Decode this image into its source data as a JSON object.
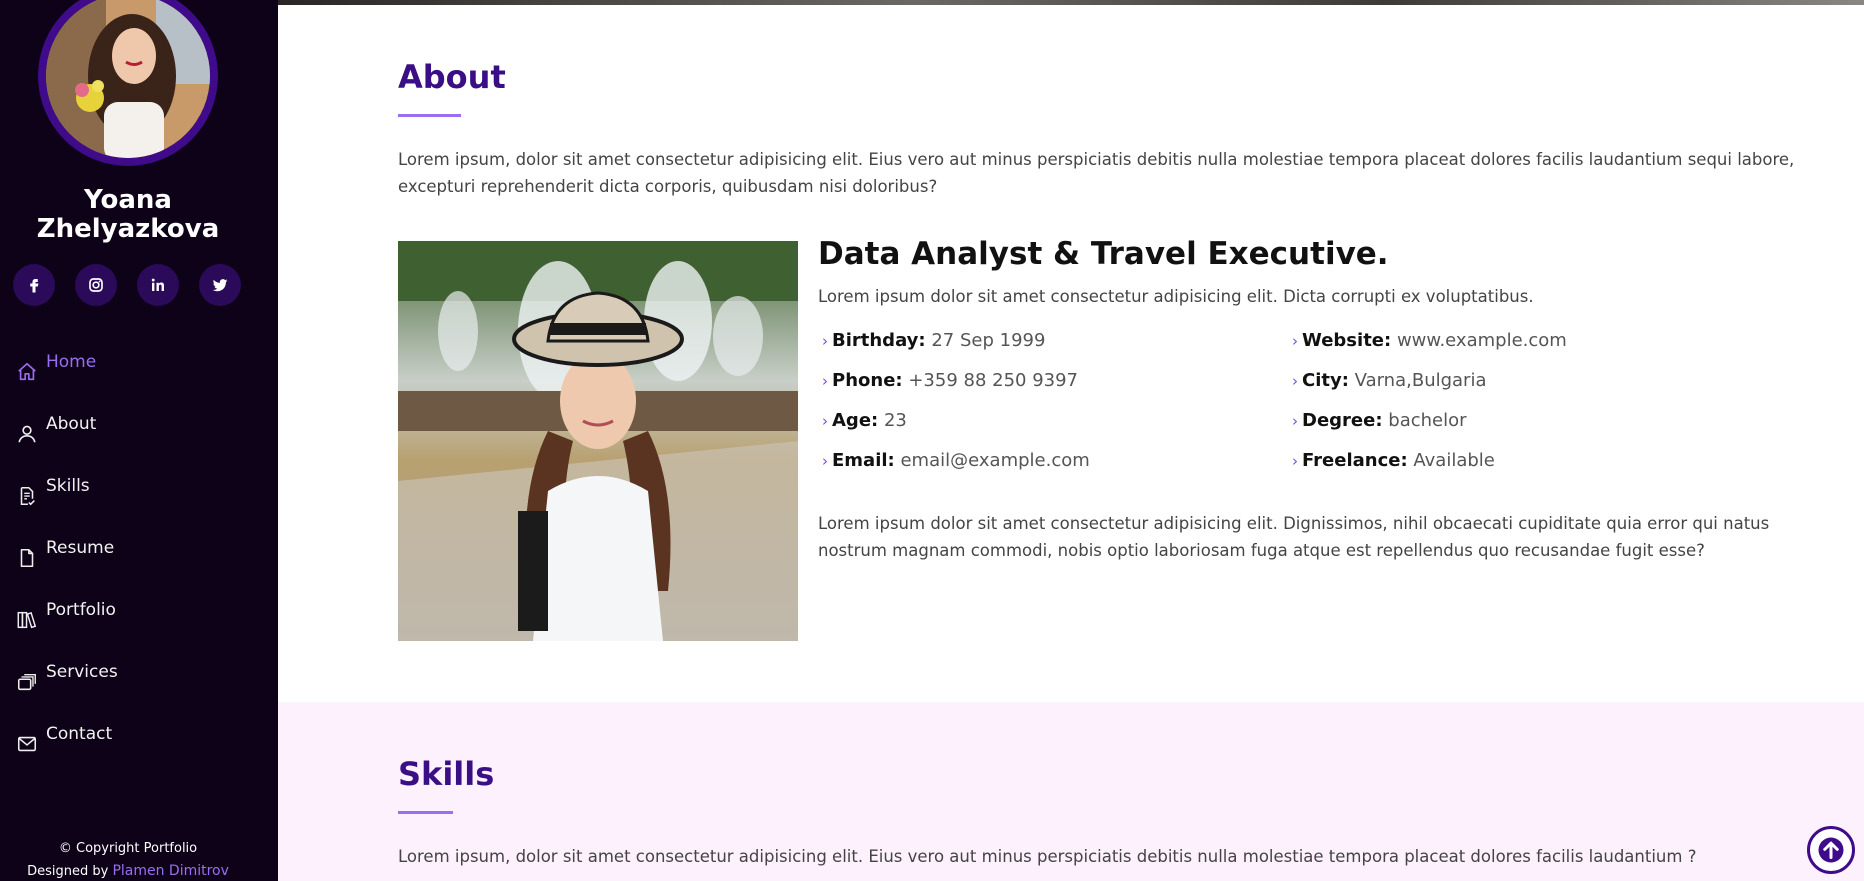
{
  "sidebar": {
    "name": "Yoana Zhelyazkova",
    "socials": [
      "facebook-icon",
      "instagram-icon",
      "linkedin-icon",
      "twitter-icon"
    ],
    "nav": [
      {
        "label": "Home",
        "icon": "home-icon",
        "active": true
      },
      {
        "label": "About",
        "icon": "user-icon",
        "active": false
      },
      {
        "label": "Skills",
        "icon": "file-check-icon",
        "active": false
      },
      {
        "label": "Resume",
        "icon": "file-icon",
        "active": false
      },
      {
        "label": "Portfolio",
        "icon": "books-icon",
        "active": false
      },
      {
        "label": "Services",
        "icon": "stack-icon",
        "active": false
      },
      {
        "label": "Contact",
        "icon": "envelope-icon",
        "active": false
      }
    ],
    "footer": {
      "copyright": "© Copyright Portfolio",
      "designed_by": "Designed by",
      "designer": "Plamen Dimitrov"
    }
  },
  "about": {
    "title": "About",
    "intro_line1": "Lorem ipsum, dolor sit amet consectetur adipisicing elit. Eius vero aut minus perspiciatis debitis nulla molestiae tempora placeat dolores facilis laudantium sequi labore,",
    "intro_line2": "excepturi reprehenderit dicta corporis, quibusdam nisi doloribus?",
    "headline": "Data Analyst & Travel Executive.",
    "subtitle": "Lorem ipsum dolor sit amet consectetur adipisicing elit. Dicta corrupti ex voluptatibus.",
    "facts": {
      "birthday": {
        "label": "Birthday:",
        "value": "27 Sep 1999"
      },
      "phone": {
        "label": "Phone:",
        "value": "+359 88 250 9397"
      },
      "age": {
        "label": "Age:",
        "value": "23"
      },
      "email": {
        "label": "Email:",
        "value": "email@example.com"
      },
      "website": {
        "label": "Website:",
        "value": "www.example.com"
      },
      "city": {
        "label": "City:",
        "value": "Varna,Bulgaria"
      },
      "degree": {
        "label": "Degree:",
        "value": "bachelor"
      },
      "freelance": {
        "label": "Freelance:",
        "value": "Available"
      }
    },
    "closing_line1": "Lorem ipsum dolor sit amet consectetur adipisicing elit. Dignissimos, nihil obcaecati cupiditate quia error qui natus",
    "closing_line2": "nostrum magnam commodi, nobis optio laboriosam fuga atque est repellendus quo recusandae fugit esse?"
  },
  "skills": {
    "title": "Skills",
    "intro": "Lorem ipsum, dolor sit amet consectetur adipisicing elit. Eius vero aut minus perspiciatis debitis nulla molestiae tempora placeat dolores facilis laudantium ?"
  },
  "colors": {
    "sidebar_bg": "#0d0218",
    "accent": "#9b6ef0",
    "title": "#3a0f86",
    "skills_bg": "#fdf1fd"
  }
}
